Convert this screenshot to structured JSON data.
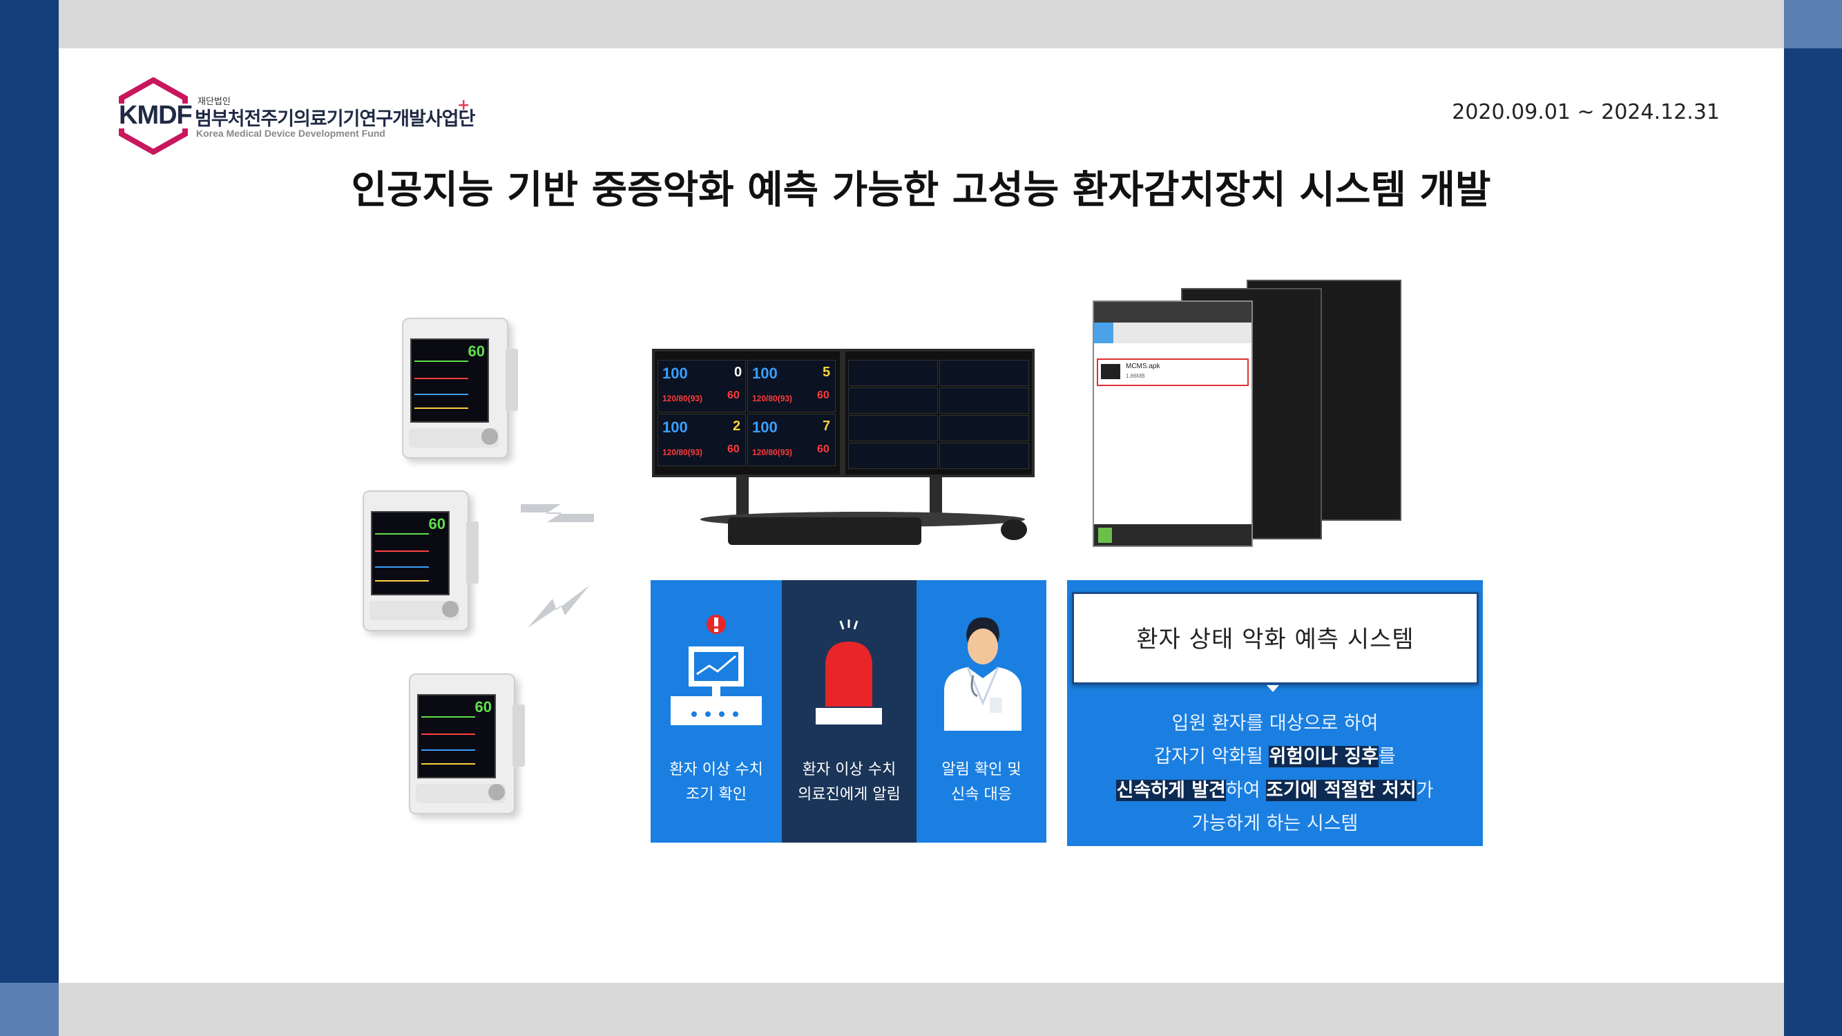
{
  "header": {
    "logo": {
      "abbr": "KMDF",
      "sub_label": "재단법인",
      "org_name": "범부처전주기의료기기연구개발사업단",
      "org_name_en": "Korea Medical Device Development Fund"
    },
    "date_range": "2020.09.01  ~  2024.12.31"
  },
  "title": "인공지능 기반 중증악화 예측 가능한 고성능 환자감치장치 시스템 개발",
  "colors": {
    "frame_blue": "#143f7a",
    "panel_blue": "#1a7fe0",
    "dark_navy": "#1b3558",
    "band_gray": "#d9d9d9"
  },
  "monitors": {
    "value": "60"
  },
  "workstation": {
    "big_values": [
      "100",
      "100",
      "100",
      "100"
    ],
    "right_values": [
      "0",
      "5",
      "2",
      "7"
    ],
    "bp_values": [
      "120/80(93)",
      "120/80(93)",
      "120/80(93)",
      "120/80(93)"
    ],
    "hr_values": [
      "60",
      "60",
      "60",
      "60"
    ]
  },
  "phone": {
    "file_name": "MCMS.apk",
    "file_size": "1.86MB"
  },
  "features": [
    {
      "icon": "monitor-alert-icon",
      "line1": "환자 이상 수치",
      "line2": "조기 확인"
    },
    {
      "icon": "siren-icon",
      "line1": "환자 이상 수치",
      "line2": "의료진에게 알림"
    },
    {
      "icon": "doctor-icon",
      "line1": "알림 확인 및",
      "line2": "신속 대응"
    }
  ],
  "prediction": {
    "title": "환자 상태 악화 예측 시스템",
    "line1": "입원 환자를 대상으로 하여",
    "line2_a": "갑자기 악화될 ",
    "line2_hl": "위험이나 징후",
    "line2_b": "를",
    "line3_hl1": "신속하게 발견",
    "line3_a": "하여 ",
    "line3_hl2": "조기에 적절한 처치",
    "line3_b": "가",
    "line4": "가능하게 하는 시스템"
  }
}
